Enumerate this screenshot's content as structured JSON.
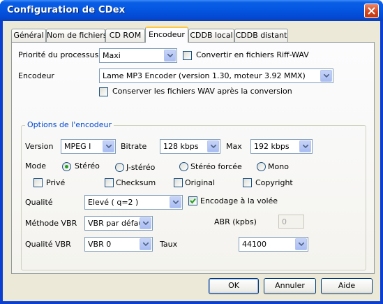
{
  "window": {
    "title": "Configuration de CDex"
  },
  "tabs": [
    {
      "label": "Général"
    },
    {
      "label": "Nom de fichiers"
    },
    {
      "label": "CD ROM"
    },
    {
      "label": "Encodeur"
    },
    {
      "label": "CDDB local"
    },
    {
      "label": "CDDB distant"
    }
  ],
  "active_tab": "Encodeur",
  "general": {
    "priority_label": "Priorité du processus",
    "priority_value": "Maxi",
    "convert_riff_label": "Convertir en fichiers Riff-WAV",
    "convert_riff_checked": false,
    "encoder_label": "Encodeur",
    "encoder_value": "Lame MP3 Encoder (version 1.30, moteur 3.92 MMX)",
    "keep_wav_label": "Conserver les fichiers WAV après la conversion",
    "keep_wav_checked": false
  },
  "options": {
    "group_title": "Options de l'encodeur",
    "version_label": "Version",
    "version_value": "MPEG I",
    "bitrate_label": "Bitrate",
    "bitrate_value": "128 kbps",
    "max_label": "Max",
    "max_value": "192 kbps",
    "mode_label": "Mode",
    "modes": [
      "Stéréo",
      "J-stéréo",
      "Stéréo forcée",
      "Mono"
    ],
    "mode_selected": "Stéréo",
    "flags": [
      {
        "label": "Privé",
        "checked": false
      },
      {
        "label": "Checksum",
        "checked": false
      },
      {
        "label": "Original",
        "checked": false
      },
      {
        "label": "Copyright",
        "checked": false
      }
    ],
    "quality_label": "Qualité",
    "quality_value": "Elevé ( q=2 )",
    "on_the_fly_label": "Encodage à la volée",
    "on_the_fly_checked": true,
    "vbr_method_label": "Méthode VBR",
    "vbr_method_value": "VBR par défaut",
    "abr_label": "ABR (kpbs)",
    "abr_value": "0",
    "vbr_quality_label": "Qualité VBR",
    "vbr_quality_value": "VBR 0",
    "rate_label": "Taux",
    "rate_value": "44100"
  },
  "buttons": {
    "ok": "OK",
    "cancel": "Annuler",
    "help": "Aide"
  },
  "colors": {
    "title_bar": "#0455e0",
    "group_title": "#0046d5",
    "face": "#ece9d8",
    "close_button": "#d2431c"
  }
}
